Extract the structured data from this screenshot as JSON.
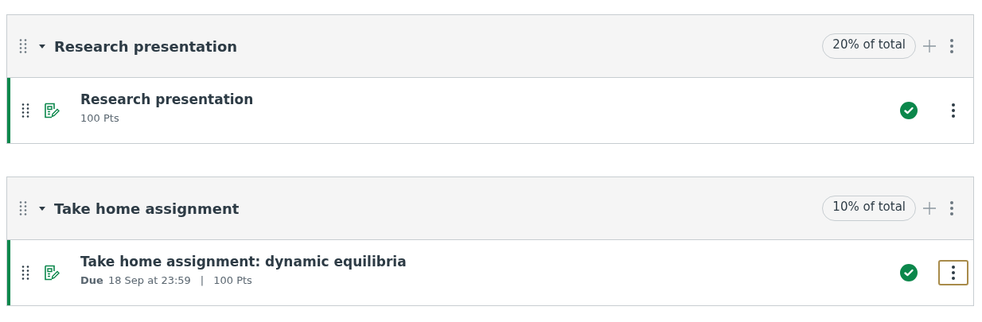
{
  "groups": [
    {
      "title": "Research presentation",
      "weight": "20% of total",
      "expanded": true,
      "items": [
        {
          "title": "Research presentation",
          "points": "100 Pts",
          "published": true,
          "menu_focused": false
        }
      ]
    },
    {
      "title": "Take home assignment",
      "weight": "10% of total",
      "expanded": true,
      "items": [
        {
          "title": "Take home assignment: dynamic equilibria",
          "due_label": "Due",
          "due": "18 Sep at 23:59",
          "separator": "|",
          "points": "100 Pts",
          "published": true,
          "menu_focused": true
        }
      ]
    }
  ]
}
